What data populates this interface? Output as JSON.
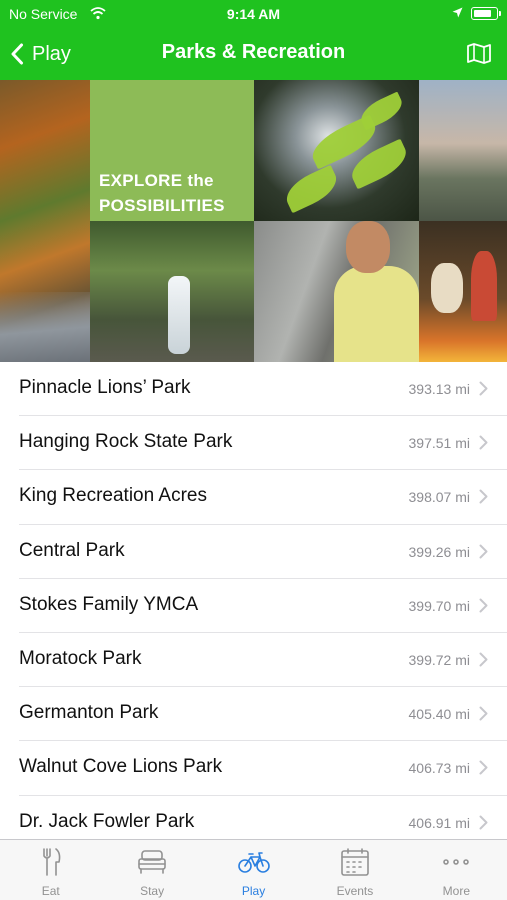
{
  "status_bar": {
    "carrier": "No Service",
    "time": "9:14 AM",
    "battery_level": 0.85
  },
  "nav": {
    "back_label": "Play",
    "title": "Parks & Recreation",
    "map_icon": "map-icon"
  },
  "banner": {
    "line1": "EXPLORE the",
    "line2": "POSSIBILITIES"
  },
  "parks": [
    {
      "name": "Pinnacle Lions’ Park",
      "distance": "393.13 mi"
    },
    {
      "name": "Hanging Rock State Park",
      "distance": "397.51 mi"
    },
    {
      "name": "King Recreation Acres",
      "distance": "398.07 mi"
    },
    {
      "name": "Central Park",
      "distance": "399.26 mi"
    },
    {
      "name": "Stokes Family YMCA",
      "distance": "399.70 mi"
    },
    {
      "name": "Moratock Park",
      "distance": "399.72 mi"
    },
    {
      "name": "Germanton Park",
      "distance": "405.40 mi"
    },
    {
      "name": "Walnut Cove Lions Park",
      "distance": "406.73 mi"
    },
    {
      "name": "Dr. Jack Fowler Park",
      "distance": "406.91 mi"
    }
  ],
  "tabs": [
    {
      "label": "Eat",
      "icon": "fork-knife-icon",
      "active": false
    },
    {
      "label": "Stay",
      "icon": "bed-icon",
      "active": false
    },
    {
      "label": "Play",
      "icon": "bicycle-icon",
      "active": true
    },
    {
      "label": "Events",
      "icon": "calendar-icon",
      "active": false
    },
    {
      "label": "More",
      "icon": "more-dots-icon",
      "active": false
    }
  ],
  "colors": {
    "header_green": "#1fc21f",
    "banner_green": "#8dbb57",
    "tab_active": "#2a7fe0",
    "tab_inactive": "#929292",
    "distance_gray": "#8e8e93"
  }
}
